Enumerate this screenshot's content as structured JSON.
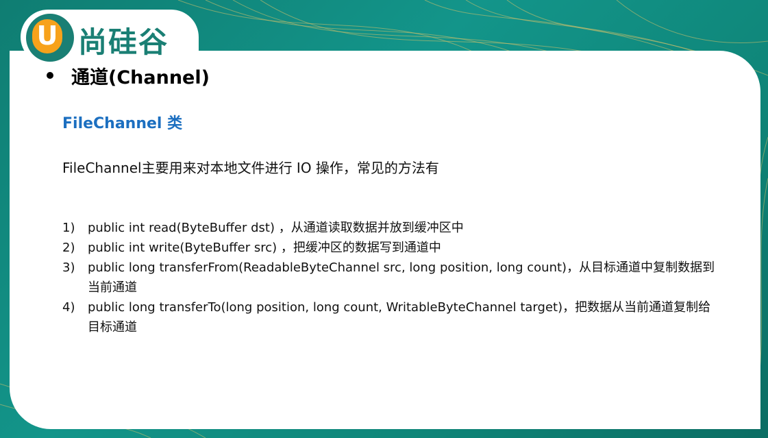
{
  "logo": {
    "letter": "U",
    "brand_name": "尚硅谷"
  },
  "slide": {
    "heading": "通道(Channel)",
    "subheading": "FileChannel 类",
    "intro": "FileChannel主要用来对本地文件进行 IO 操作，常见的方法有",
    "methods": [
      {
        "number": "1)",
        "text": "public int read(ByteBuffer dst) ，从通道读取数据并放到缓冲区中"
      },
      {
        "number": "2)",
        "text": "public int write(ByteBuffer src) ，把缓冲区的数据写到通道中"
      },
      {
        "number": "3)",
        "text": "public long transferFrom(ReadableByteChannel src, long position, long count)，从目标通道中复制数据到当前通道"
      },
      {
        "number": "4)",
        "text": "public long transferTo(long position, long count, WritableByteChannel  target)，把数据从当前通道复制给目标通道"
      }
    ]
  },
  "colors": {
    "background_teal": "#13958a",
    "logo_teal": "#1a7f74",
    "logo_orange": "#f7a21b",
    "subheading_blue": "#1c6fc0",
    "deco_gold": "#d8c26a"
  }
}
